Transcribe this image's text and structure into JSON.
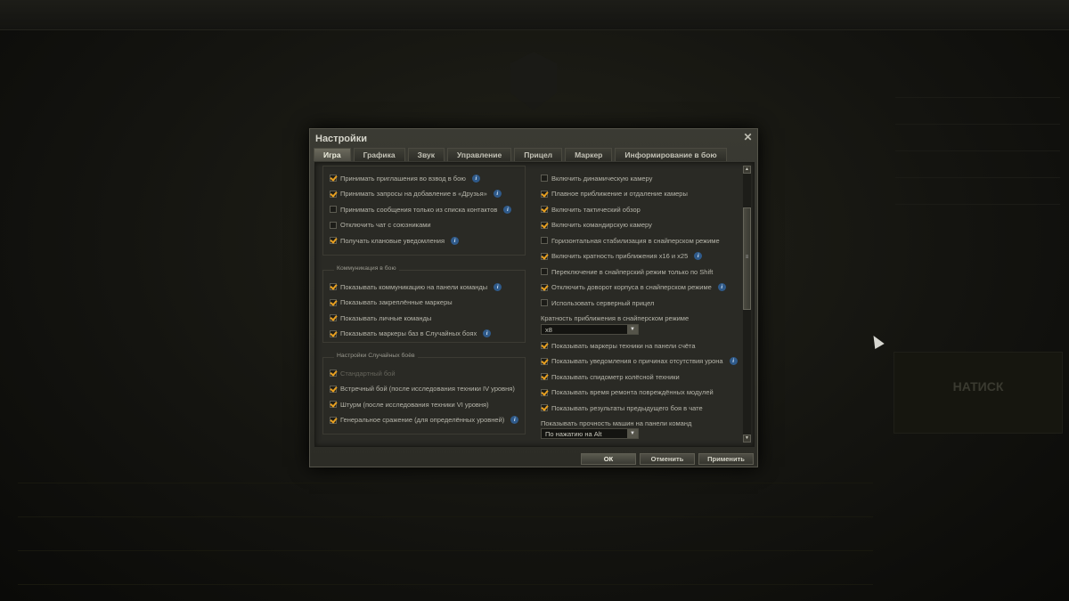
{
  "dialog": {
    "title": "Настройки",
    "close_glyph": "✕",
    "tabs": [
      {
        "label": "Игра",
        "active": true
      },
      {
        "label": "Графика",
        "active": false
      },
      {
        "label": "Звук",
        "active": false
      },
      {
        "label": "Управление",
        "active": false
      },
      {
        "label": "Прицел",
        "active": false
      },
      {
        "label": "Маркер",
        "active": false
      },
      {
        "label": "Информирование в бою",
        "active": false
      }
    ],
    "left": {
      "top_options": [
        {
          "label": "Принимать приглашения во взвод в бою",
          "checked": true,
          "info": true
        },
        {
          "label": "Принимать запросы на добавление в «Друзья»",
          "checked": true,
          "info": true
        },
        {
          "label": "Принимать сообщения только из списка контактов",
          "checked": false,
          "info": true
        },
        {
          "label": "Отключить чат с союзниками",
          "checked": false,
          "info": false
        },
        {
          "label": "Получать клановые уведомления",
          "checked": true,
          "info": true
        }
      ],
      "comm_group": {
        "title": "Коммуникация в бою",
        "options": [
          {
            "label": "Показывать коммуникацию на панели команды",
            "checked": true,
            "info": true
          },
          {
            "label": "Показывать закреплённые маркеры",
            "checked": true,
            "info": false
          },
          {
            "label": "Показывать личные команды",
            "checked": true,
            "info": false
          },
          {
            "label": "Показывать маркеры баз в Случайных боях",
            "checked": true,
            "info": true
          }
        ]
      },
      "random_group": {
        "title": "Настройки Случайных боёв",
        "options": [
          {
            "label": "Стандартный бой",
            "checked": true,
            "info": false,
            "disabled": true
          },
          {
            "label": "Встречный бой (после исследования техники IV уровня)",
            "checked": true,
            "info": false
          },
          {
            "label": "Штурм (после исследования техники VI уровня)",
            "checked": true,
            "info": false
          },
          {
            "label": "Генеральное сражение (для определённых уровней)",
            "checked": true,
            "info": true
          }
        ]
      }
    },
    "right": {
      "options_a": [
        {
          "label": "Включить динамическую камеру",
          "checked": false,
          "info": false
        },
        {
          "label": "Плавное приближение и отдаление камеры",
          "checked": true,
          "info": false
        },
        {
          "label": "Включить тактический обзор",
          "checked": true,
          "info": false
        },
        {
          "label": "Включить командирскую камеру",
          "checked": true,
          "info": false
        },
        {
          "label": "Горизонтальная стабилизация в снайперском режиме",
          "checked": false,
          "info": false
        },
        {
          "label": "Включить кратность приближения x16 и x25",
          "checked": true,
          "info": true
        },
        {
          "label": "Переключение в снайперский режим только по Shift",
          "checked": false,
          "info": false
        },
        {
          "label": "Отключить доворот корпуса в снайперском режиме",
          "checked": true,
          "info": true
        },
        {
          "label": "Использовать серверный прицел",
          "checked": false,
          "info": false
        }
      ],
      "zoom_label": "Кратность приближения в снайперском режиме",
      "zoom_value": "x8",
      "options_b": [
        {
          "label": "Показывать маркеры техники на панели счёта",
          "checked": true,
          "info": false
        },
        {
          "label": "Показывать уведомления о причинах отсутствия урона",
          "checked": true,
          "info": true
        },
        {
          "label": "Показывать спидометр колёсной техники",
          "checked": true,
          "info": false
        },
        {
          "label": "Показывать время ремонта повреждённых модулей",
          "checked": true,
          "info": false
        },
        {
          "label": "Показывать результаты предыдущего боя в чате",
          "checked": true,
          "info": false
        }
      ],
      "hp_label": "Показывать прочность машин на панели команд",
      "hp_value": "По нажатию на Alt"
    },
    "buttons": {
      "ok": "ОК",
      "cancel": "Отменить",
      "apply": "Применить"
    },
    "info_glyph": "i",
    "scroll_up": "▲",
    "scroll_down": "▼",
    "thumb_grip": "≡",
    "select_arrow": "▼"
  },
  "background": {
    "battle_label": "НАТИСК"
  },
  "colors": {
    "check_accent": "#e8a020",
    "info_blue": "#2f5a8a"
  }
}
